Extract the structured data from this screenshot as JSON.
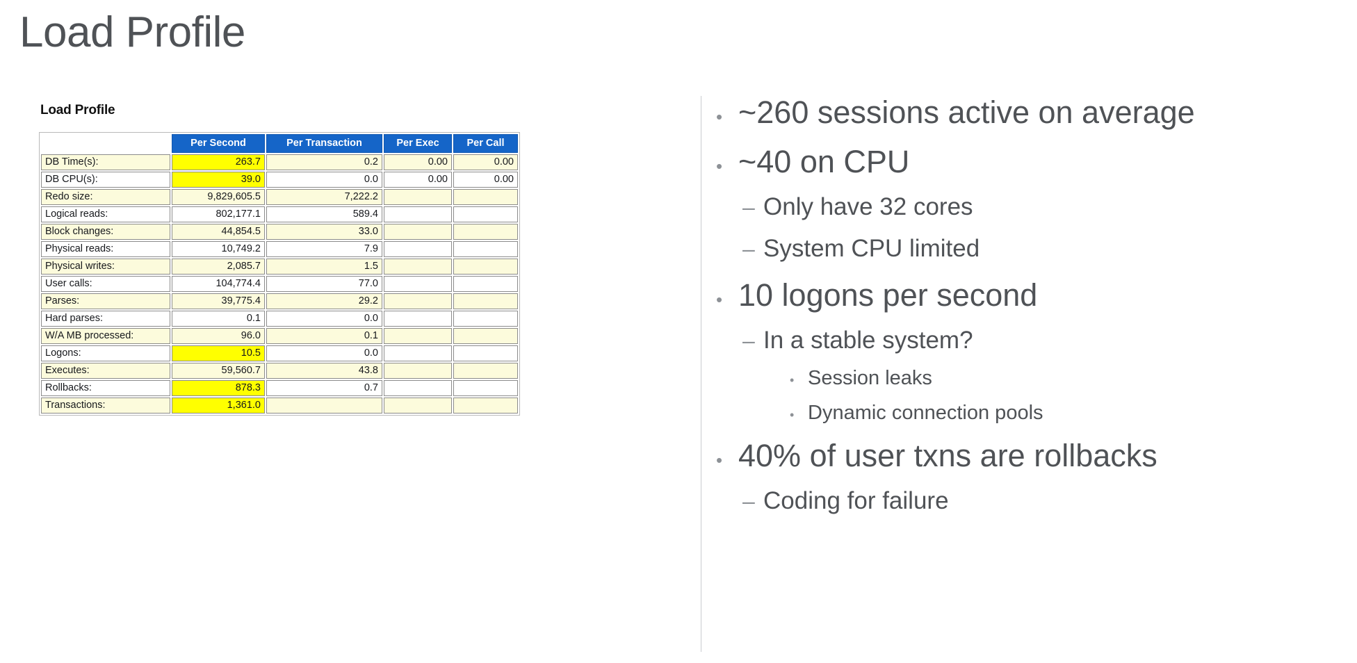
{
  "slide": {
    "title": "Load Profile"
  },
  "awr": {
    "caption": "Load Profile",
    "columns": [
      "",
      "Per Second",
      "Per Transaction",
      "Per Exec",
      "Per Call"
    ],
    "header_bg": "#1565c8",
    "highlight_color": "#ffff00",
    "alt_row_color": "#fcfbdc",
    "rows": [
      {
        "label": "DB Time(s):",
        "per_second": "263.7",
        "per_transaction": "0.2",
        "per_exec": "0.00",
        "per_call": "0.00"
      },
      {
        "label": "DB CPU(s):",
        "per_second": "39.0",
        "per_transaction": "0.0",
        "per_exec": "0.00",
        "per_call": "0.00"
      },
      {
        "label": "Redo size:",
        "per_second": "9,829,605.5",
        "per_transaction": "7,222.2",
        "per_exec": "",
        "per_call": ""
      },
      {
        "label": "Logical reads:",
        "per_second": "802,177.1",
        "per_transaction": "589.4",
        "per_exec": "",
        "per_call": ""
      },
      {
        "label": "Block changes:",
        "per_second": "44,854.5",
        "per_transaction": "33.0",
        "per_exec": "",
        "per_call": ""
      },
      {
        "label": "Physical reads:",
        "per_second": "10,749.2",
        "per_transaction": "7.9",
        "per_exec": "",
        "per_call": ""
      },
      {
        "label": "Physical writes:",
        "per_second": "2,085.7",
        "per_transaction": "1.5",
        "per_exec": "",
        "per_call": ""
      },
      {
        "label": "User calls:",
        "per_second": "104,774.4",
        "per_transaction": "77.0",
        "per_exec": "",
        "per_call": ""
      },
      {
        "label": "Parses:",
        "per_second": "39,775.4",
        "per_transaction": "29.2",
        "per_exec": "",
        "per_call": ""
      },
      {
        "label": "Hard parses:",
        "per_second": "0.1",
        "per_transaction": "0.0",
        "per_exec": "",
        "per_call": ""
      },
      {
        "label": "W/A MB processed:",
        "per_second": "96.0",
        "per_transaction": "0.1",
        "per_exec": "",
        "per_call": ""
      },
      {
        "label": "Logons:",
        "per_second": "10.5",
        "per_transaction": "0.0",
        "per_exec": "",
        "per_call": ""
      },
      {
        "label": "Executes:",
        "per_second": "59,560.7",
        "per_transaction": "43.8",
        "per_exec": "",
        "per_call": ""
      },
      {
        "label": "Rollbacks:",
        "per_second": "878.3",
        "per_transaction": "0.7",
        "per_exec": "",
        "per_call": ""
      },
      {
        "label": "Transactions:",
        "per_second": "1,361.0",
        "per_transaction": "",
        "per_exec": "",
        "per_call": ""
      }
    ]
  },
  "bullets": [
    {
      "level": 1,
      "marker": "•",
      "text": "~260 sessions active on average"
    },
    {
      "level": 1,
      "marker": "•",
      "text": "~40 on CPU"
    },
    {
      "level": 2,
      "marker": "–",
      "text": "Only have 32 cores"
    },
    {
      "level": 2,
      "marker": "–",
      "text": "System CPU limited"
    },
    {
      "level": 1,
      "marker": "•",
      "text": "10 logons per second"
    },
    {
      "level": 2,
      "marker": "–",
      "text": "In a stable system?"
    },
    {
      "level": 3,
      "marker": "•",
      "text": "Session leaks"
    },
    {
      "level": 3,
      "marker": "•",
      "text": "Dynamic connection pools"
    },
    {
      "level": 1,
      "marker": "•",
      "text": "40% of user txns are rollbacks"
    },
    {
      "level": 2,
      "marker": "–",
      "text": "Coding for failure"
    }
  ]
}
